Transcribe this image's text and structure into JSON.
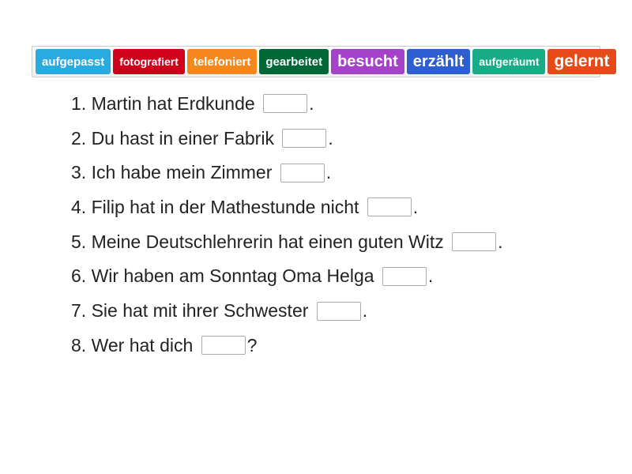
{
  "word_bank": [
    {
      "label": "aufgepasst",
      "color": "#29abe2",
      "size": 15
    },
    {
      "label": "fotografiert",
      "color": "#d0021b",
      "size": 14
    },
    {
      "label": "telefoniert",
      "color": "#f5871f",
      "size": 15
    },
    {
      "label": "gearbeitet",
      "color": "#006837",
      "size": 15
    },
    {
      "label": "besucht",
      "color": "#a442c9",
      "size": 20
    },
    {
      "label": "erzählt",
      "color": "#2d5fd0",
      "size": 20
    },
    {
      "label": "aufgeräumt",
      "color": "#17ab86",
      "size": 14
    },
    {
      "label": "gelernt",
      "color": "#e64a19",
      "size": 21
    }
  ],
  "sentences": [
    {
      "pre": "1. Martin hat Erdkunde ",
      "post": "."
    },
    {
      "pre": "2. Du hast in einer Fabrik ",
      "post": "."
    },
    {
      "pre": "3. Ich habe mein Zimmer ",
      "post": "."
    },
    {
      "pre": "4. Filip hat in der Mathestunde nicht ",
      "post": "."
    },
    {
      "pre": "5. Meine Deutschlehrerin hat einen guten Witz ",
      "post": "."
    },
    {
      "pre": "6. Wir haben am Sonntag Oma Helga ",
      "post": "."
    },
    {
      "pre": "7. Sie hat mit ihrer Schwester ",
      "post": "."
    },
    {
      "pre": "8. Wer hat dich ",
      "post": "?"
    }
  ]
}
